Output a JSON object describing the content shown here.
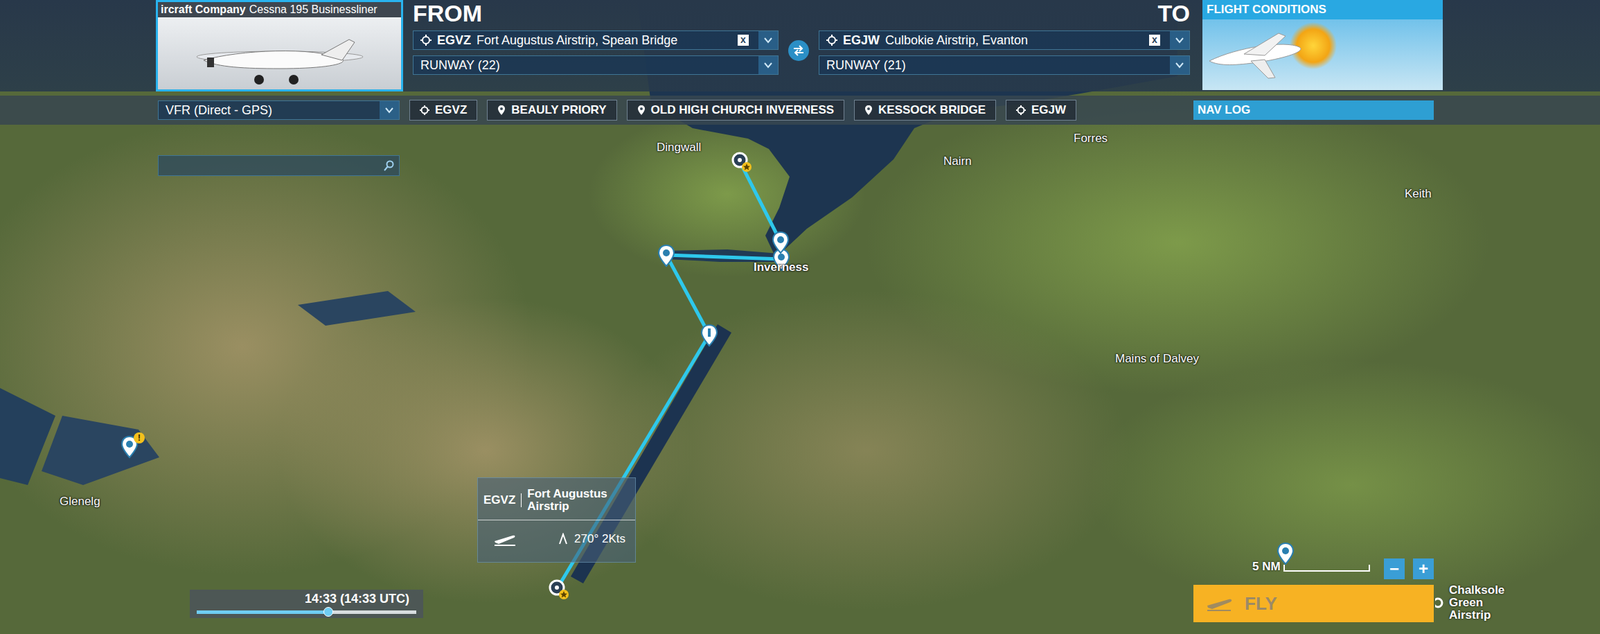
{
  "aircraft": {
    "company": "ircraft Company",
    "model": "Cessna 195 Businessliner"
  },
  "departure": {
    "title": "FROM",
    "code": "EGVZ",
    "name": "Fort Augustus Airstrip, Spean Bridge",
    "clear": "x",
    "runway": "RUNWAY (22)"
  },
  "arrival": {
    "title": "TO",
    "code": "EGJW",
    "name": "Culbokie Airstrip, Evanton",
    "clear": "x",
    "runway": "RUNWAY (21)"
  },
  "conditions": {
    "title": "FLIGHT CONDITIONS"
  },
  "flight_plan": {
    "type": "VFR (Direct - GPS)",
    "waypoints": [
      {
        "label": "EGVZ",
        "kind": "airport"
      },
      {
        "label": "BEAULY PRIORY",
        "kind": "poi"
      },
      {
        "label": "OLD HIGH CHURCH INVERNESS",
        "kind": "poi"
      },
      {
        "label": "KESSOCK BRIDGE",
        "kind": "poi"
      },
      {
        "label": "EGJW",
        "kind": "airport"
      }
    ]
  },
  "nav_log": {
    "label": "NAV LOG"
  },
  "map": {
    "places": [
      {
        "text": "Dingwall",
        "bold": false
      },
      {
        "text": "Nairn",
        "bold": false
      },
      {
        "text": "Forres",
        "bold": false
      },
      {
        "text": "Keith",
        "bold": false
      },
      {
        "text": "Inverness",
        "bold": true
      },
      {
        "text": "Mains of Dalvey",
        "bold": false
      },
      {
        "text": "Glenelg",
        "bold": false
      }
    ],
    "route_markers": [
      {
        "kind": "airport"
      },
      {
        "kind": "user"
      },
      {
        "kind": "poi"
      },
      {
        "kind": "poi"
      },
      {
        "kind": "poi"
      },
      {
        "kind": "airport"
      }
    ],
    "other_pins": [
      {
        "kind": "poi",
        "badge": ""
      },
      {
        "kind": "poi",
        "badge": "!"
      }
    ],
    "nearby_airport": {
      "label": "Chalksole Green Airstrip"
    }
  },
  "airport_card": {
    "code": "EGVZ",
    "name": "Fort Augustus Airstrip",
    "wind": "270° 2Kts"
  },
  "time": {
    "label": "14:33 (14:33 UTC)",
    "level": 0.6
  },
  "scale": {
    "label": "5 NM"
  },
  "zoom": [
    "−",
    "+"
  ],
  "fly": {
    "label": "FLY"
  }
}
